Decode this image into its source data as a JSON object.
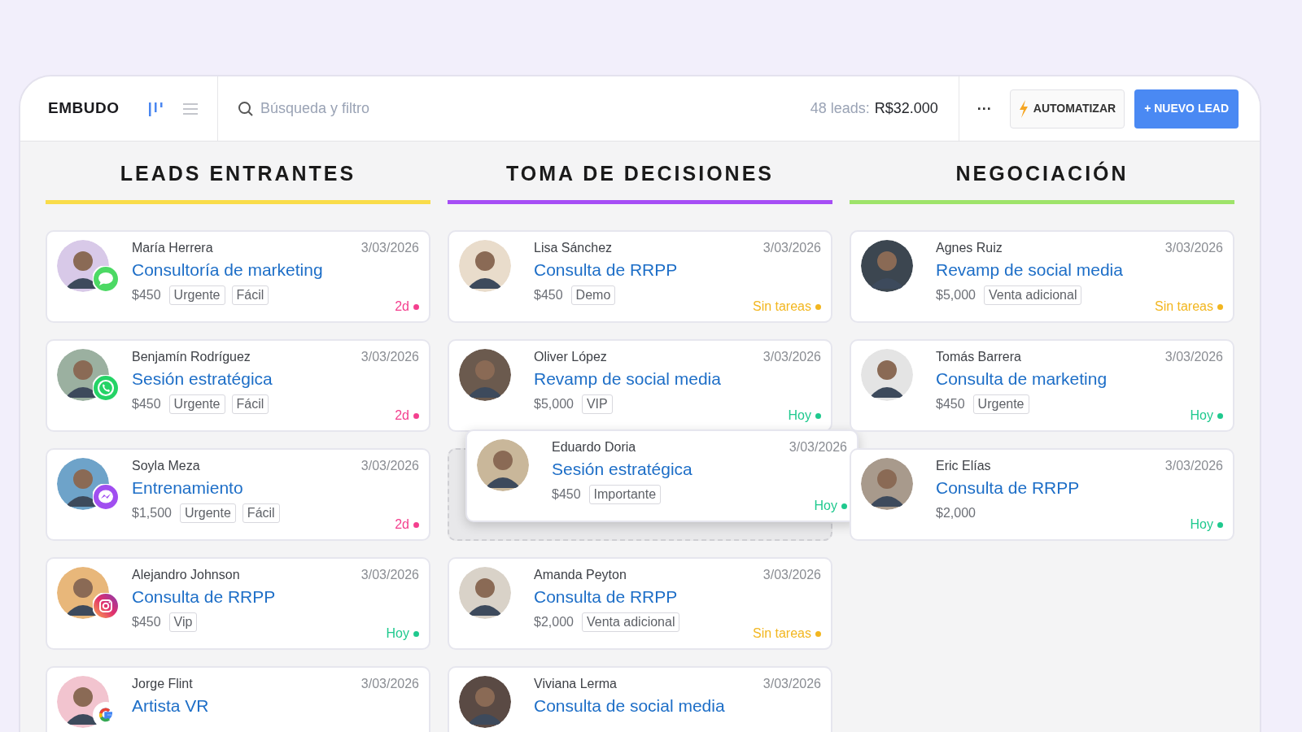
{
  "toolbar": {
    "title": "EMBUDO",
    "views": [
      {
        "kind": "board",
        "selected": true
      },
      {
        "kind": "list",
        "selected": false
      }
    ],
    "search": {
      "placeholder": "Búsqueda y filtro"
    },
    "summary_label": "48 leads:",
    "summary_value": "R$32.000",
    "more": "···",
    "automate": "AUTOMATIZAR",
    "new_lead": "+ NUEVO LEAD"
  },
  "columns": [
    {
      "title": "LEADS ENTRANTES",
      "color": "#f9dc4a",
      "cards": [
        {
          "name": "María Herrera",
          "date": "3/03/2026",
          "title": "Consultoría de marketing",
          "price": "$450",
          "tags": [
            "Urgente",
            "Fácil"
          ],
          "channel": {
            "kind": "sms"
          },
          "status": {
            "text": "2d",
            "color": "#f43f8e"
          }
        },
        {
          "name": "Benjamín Rodríguez",
          "date": "3/03/2026",
          "title": "Sesión estratégica",
          "price": "$450",
          "tags": [
            "Urgente",
            "Fácil"
          ],
          "channel": {
            "kind": "whatsapp"
          },
          "status": {
            "text": "2d",
            "color": "#f43f8e"
          }
        },
        {
          "name": "Soyla Meza",
          "date": "3/03/2026",
          "title": "Entrenamiento",
          "price": "$1,500",
          "tags": [
            "Urgente",
            "Fácil"
          ],
          "channel": {
            "kind": "messenger"
          },
          "status": {
            "text": "2d",
            "color": "#f43f8e"
          }
        },
        {
          "name": "Alejandro Johnson",
          "date": "3/03/2026",
          "title": "Consulta de RRPP",
          "price": "$450",
          "tags": [
            "Vip"
          ],
          "channel": {
            "kind": "instagram"
          },
          "status": {
            "text": "Hoy",
            "color": "#1fc98e"
          }
        },
        {
          "name": "Jorge Flint",
          "date": "3/03/2026",
          "title": "Artista VR",
          "channel": {
            "kind": "google"
          }
        }
      ]
    },
    {
      "title": "TOMA DE DECISIONES",
      "color": "#a64ef5",
      "cards": [
        {
          "name": "Lisa Sánchez",
          "date": "3/03/2026",
          "title": "Consulta de RRPP",
          "price": "$450",
          "tags": [
            "Demo"
          ],
          "status": {
            "text": "Sin tareas",
            "color": "#f2b61f"
          }
        },
        {
          "name": "Oliver López",
          "date": "3/03/2026",
          "title": "Revamp de social media",
          "price": "$5,000",
          "tags": [
            "VIP"
          ],
          "status": {
            "text": "Hoy",
            "color": "#1fc98e"
          }
        },
        {
          "kind": "placeholder",
          "dragged": {
            "name": "Eduardo Doria",
            "date": "3/03/2026",
            "title": "Sesión estratégica",
            "price": "$450",
            "tags": [
              "Importante"
            ],
            "status": {
              "text": "Hoy",
              "color": "#1fc98e"
            }
          }
        },
        {
          "name": "Amanda Peyton",
          "date": "3/03/2026",
          "title": "Consulta de RRPP",
          "price": "$2,000",
          "tags": [
            "Venta adicional"
          ],
          "status": {
            "text": "Sin tareas",
            "color": "#f2b61f"
          }
        },
        {
          "name": "Viviana Lerma",
          "date": "3/03/2026",
          "title": "Consulta de social media"
        }
      ]
    },
    {
      "title": "NEGOCIACIÓN",
      "color": "#9ee36a",
      "cards": [
        {
          "name": "Agnes Ruiz",
          "date": "3/03/2026",
          "title": "Revamp de social media",
          "price": "$5,000",
          "tags": [
            "Venta adicional"
          ],
          "status": {
            "text": "Sin tareas",
            "color": "#f2b61f"
          }
        },
        {
          "name": "Tomás Barrera",
          "date": "3/03/2026",
          "title": "Consulta de marketing",
          "price": "$450",
          "tags": [
            "Urgente"
          ],
          "status": {
            "text": "Hoy",
            "color": "#1fc98e"
          }
        },
        {
          "name": "Eric Elías",
          "date": "3/03/2026",
          "title": "Consulta de RRPP",
          "price": "$2,000",
          "status": {
            "text": "Hoy",
            "color": "#1fc98e"
          }
        }
      ]
    }
  ]
}
